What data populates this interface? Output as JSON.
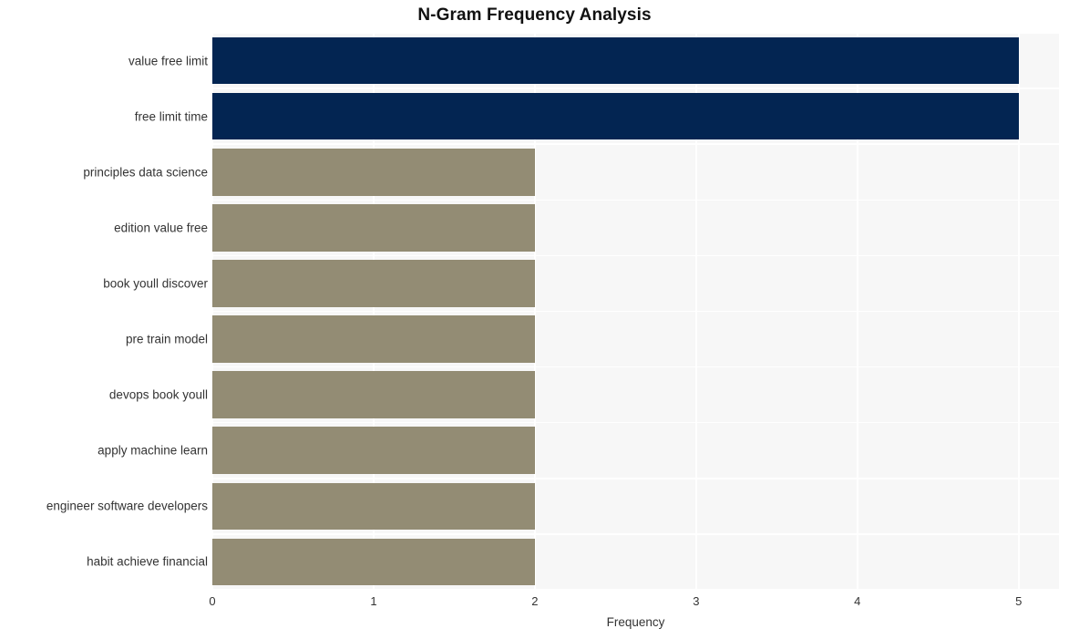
{
  "chart_data": {
    "type": "bar",
    "orientation": "horizontal",
    "title": "N-Gram Frequency Analysis",
    "xlabel": "Frequency",
    "ylabel": "",
    "categories": [
      "value free limit",
      "free limit time",
      "principles data science",
      "edition value free",
      "book youll discover",
      "pre train model",
      "devops book youll",
      "apply machine learn",
      "engineer software developers",
      "habit achieve financial"
    ],
    "values": [
      5,
      5,
      2,
      2,
      2,
      2,
      2,
      2,
      2,
      2
    ],
    "xlim": [
      0,
      5.25
    ],
    "xticks": [
      0,
      1,
      2,
      3,
      4,
      5
    ],
    "xticklabels": [
      "0",
      "1",
      "2",
      "3",
      "4",
      "5"
    ],
    "grid": true,
    "legend": false,
    "bar_colors": [
      "#032552",
      "#032552",
      "#938c74",
      "#938c74",
      "#938c74",
      "#938c74",
      "#938c74",
      "#938c74",
      "#938c74",
      "#938c74"
    ],
    "colors": {
      "highlight": "#032552",
      "normal": "#938c74",
      "plot_background": "#f7f7f7",
      "figure_background": "#ffffff",
      "gridline": "#ffffff",
      "text": "#333333",
      "title_text": "#111111"
    }
  }
}
